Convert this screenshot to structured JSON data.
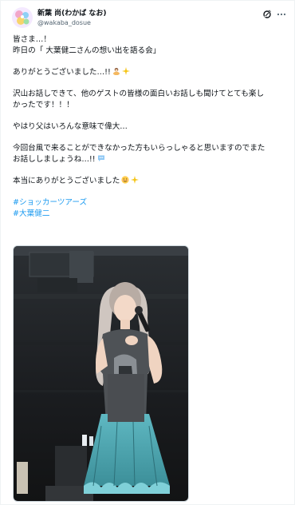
{
  "author": {
    "display_name": "新葉 尚(わかば なお)",
    "handle": "@wakaba_dosue"
  },
  "body_lines": [
    "皆さま…！",
    "昨日の「 大葉健二さんの想い出を語る会」",
    "",
    "ありがとうございました…!!",
    "",
    "沢山お話しできて、他のゲストの皆様の面白いお話しも聞けてとても楽し",
    "かったです！！！",
    "",
    "やはり父はいろんな意味で偉大…",
    "",
    "今回台風で来ることができなかった方もいらっしゃると思いますのでまた",
    "お話ししましょうね…!!",
    "",
    "本当にありがとうございました"
  ],
  "hashtags": [
    "#ショッカーツアーズ",
    "#大葉健二"
  ],
  "icons": {
    "grok": "grok-icon",
    "more": "more-options-icon",
    "avatar": "avatar-image",
    "emoji": [
      "bowing-person-emoji",
      "sparkles-emoji",
      "speech-bubble-emoji",
      "smiling-face-emoji",
      "sparkles-emoji"
    ]
  },
  "colors": {
    "link": "#1d9bf0",
    "text": "#0f1419",
    "secondary": "#536471"
  }
}
